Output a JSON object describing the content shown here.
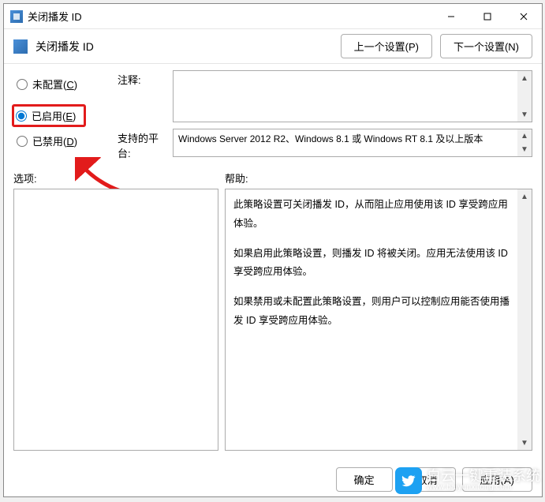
{
  "window": {
    "title": "关闭播发 ID"
  },
  "header": {
    "title": "关闭播发 ID",
    "prev_setting": "上一个设置(P)",
    "next_setting": "下一个设置(N)"
  },
  "radios": {
    "not_configured": "未配置(C)",
    "not_configured_key": "C",
    "enabled": "已启用(E)",
    "enabled_key": "E",
    "disabled": "已禁用(D)",
    "disabled_key": "D",
    "selected": "enabled"
  },
  "fields": {
    "comment_label": "注释:",
    "comment_value": "",
    "platform_label": "支持的平台:",
    "platform_value": "Windows Server 2012 R2、Windows 8.1 或 Windows RT 8.1 及以上版本"
  },
  "bottom": {
    "options_label": "选项:",
    "help_label": "帮助:"
  },
  "help": {
    "p1": "此策略设置可关闭播发 ID，从而阻止应用使用该 ID 享受跨应用体验。",
    "p2": "如果启用此策略设置，则播发 ID 将被关闭。应用无法使用该 ID 享受跨应用体验。",
    "p3": "如果禁用或未配置此策略设置，则用户可以控制应用能否使用播发 ID 享受跨应用体验。"
  },
  "footer": {
    "ok": "确定",
    "cancel": "取消",
    "apply": "应用(A)"
  },
  "watermark": {
    "brand": "白云一键重装系统",
    "url": "www.baiyunxitong.com"
  }
}
